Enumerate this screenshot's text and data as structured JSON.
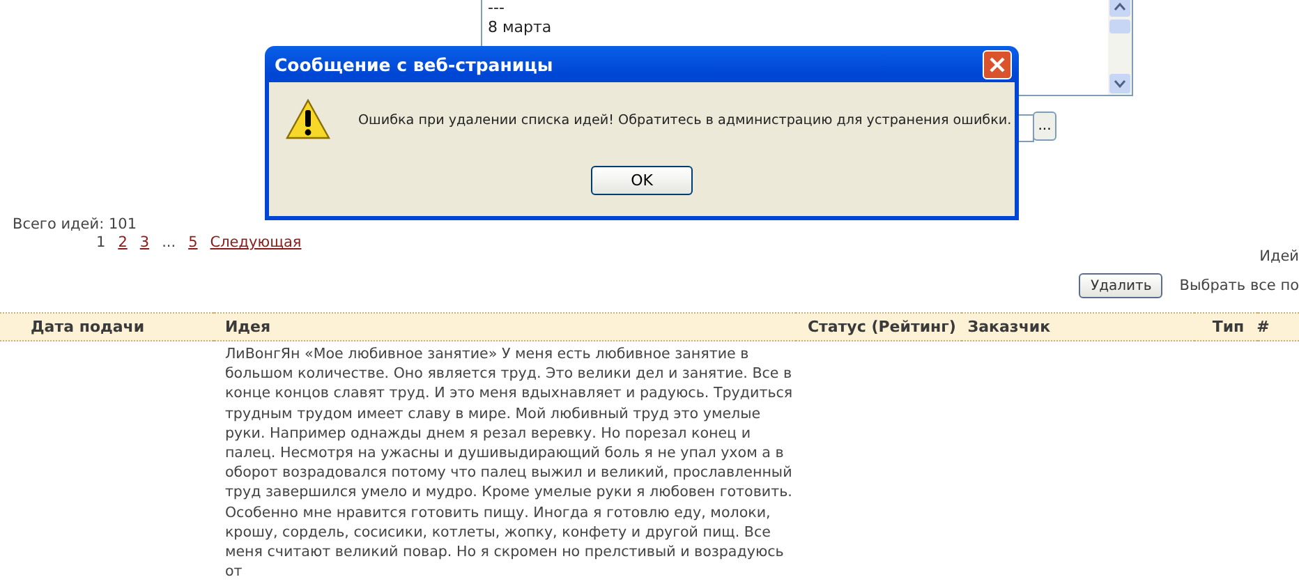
{
  "background_form": {
    "topic_lines": [
      "---",
      "8 марта"
    ],
    "browse_button": "..."
  },
  "dialog": {
    "title": "Сообщение с веб-страницы",
    "message": "Ошибка при удалении списка идей! Обратитесь в администрацию для устранения ошибки.",
    "ok_button": "OK"
  },
  "summary": "Всего идей: 101",
  "pager": [
    {
      "kind": "page",
      "label": "1",
      "selected": true
    },
    {
      "kind": "page",
      "label": "2",
      "selected": false
    },
    {
      "kind": "page",
      "label": "3",
      "selected": false
    },
    {
      "kind": "gap",
      "label": "..."
    },
    {
      "kind": "page",
      "label": "5",
      "selected": false
    },
    {
      "kind": "next",
      "label": "Следующая"
    }
  ],
  "ideas_label": "Идей",
  "delete_button": "Удалить",
  "select_all": "Выбрать все по",
  "table": {
    "columns": [
      "Дата подачи",
      "Идея",
      "Статус (Рейтинг)",
      "Заказчик",
      "Тип",
      "#"
    ],
    "rows": [
      {
        "idea": "ЛиВонгЯн «Мое любивное занятие» У меня есть любивное занятие в большом количестве. Оно является труд. Это велики дел и занятие. Все в конце концов славят труд. И это меня вдыхнавляет и радуюсь. Трудиться трудным трудом имеет славу в мире. Мой любивный труд это умелые руки. Например однажды днем я резал веревку. Но порезал конец и палец. Несмотря на ужасны и душивыдирающий боль я не упал ухом а в оборот возрадовался потому что палец выжил и великий, прославленный труд завершился умело и мудро. Кроме умелые руки я любовен готовить. Особенно мне нравится готовить пищу. Иногда я готовлю еду, молоки, крошу, сордель, сосисики, котлеты, жопку, конфету и другой пищ. Все меня считают великий повар. Но я скромен но прелстивый и возрадуюсь от"
      }
    ]
  }
}
